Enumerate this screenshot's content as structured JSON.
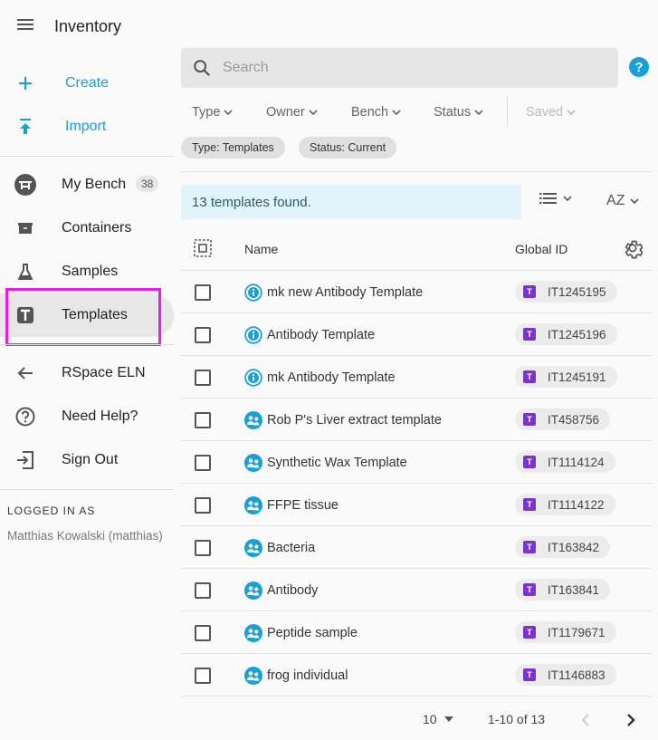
{
  "app": {
    "title": "Inventory"
  },
  "sidebar": {
    "create_label": "Create",
    "import_label": "Import",
    "items": [
      {
        "label": "My Bench",
        "badge": "38"
      },
      {
        "label": "Containers"
      },
      {
        "label": "Samples"
      },
      {
        "label": "Templates"
      },
      {
        "label": "RSpace ELN"
      },
      {
        "label": "Need Help?"
      },
      {
        "label": "Sign Out"
      }
    ],
    "logged_in_label": "LOGGED IN AS",
    "user_name": "Matthias Kowalski (matthias)"
  },
  "search": {
    "placeholder": "Search"
  },
  "filters": {
    "type": "Type",
    "owner": "Owner",
    "bench": "Bench",
    "status": "Status",
    "saved": "Saved"
  },
  "chips": {
    "type": "Type: Templates",
    "status": "Status: Current"
  },
  "results": {
    "summary": "13 templates found.",
    "sort_label": "AZ"
  },
  "table": {
    "columns": {
      "name": "Name",
      "global_id": "Global ID"
    },
    "rows": [
      {
        "name": "mk new Antibody Template",
        "global_id": "IT1245195",
        "icon": "info-icon"
      },
      {
        "name": "Antibody Template",
        "global_id": "IT1245196",
        "icon": "info-icon"
      },
      {
        "name": "mk Antibody Template",
        "global_id": "IT1245191",
        "icon": "info-icon"
      },
      {
        "name": "Rob P's Liver extract template",
        "global_id": "IT458756",
        "icon": "group-icon"
      },
      {
        "name": "Synthetic Wax Template",
        "global_id": "IT1114124",
        "icon": "group-icon"
      },
      {
        "name": "FFPE tissue",
        "global_id": "IT1114122",
        "icon": "group-icon"
      },
      {
        "name": "Bacteria",
        "global_id": "IT163842",
        "icon": "group-icon"
      },
      {
        "name": "Antibody",
        "global_id": "IT163841",
        "icon": "group-icon"
      },
      {
        "name": "Peptide sample",
        "global_id": "IT1179671",
        "icon": "group-icon"
      },
      {
        "name": "frog individual",
        "global_id": "IT1146883",
        "icon": "group-icon"
      }
    ],
    "type_badge": "T"
  },
  "pagination": {
    "page_size": "10",
    "range": "1-10 of 13"
  },
  "colors": {
    "accent": "#1aa0d8",
    "highlight": "#e81ee8",
    "template_badge": "#7a33cc",
    "banner_bg": "#e1f3fb"
  }
}
